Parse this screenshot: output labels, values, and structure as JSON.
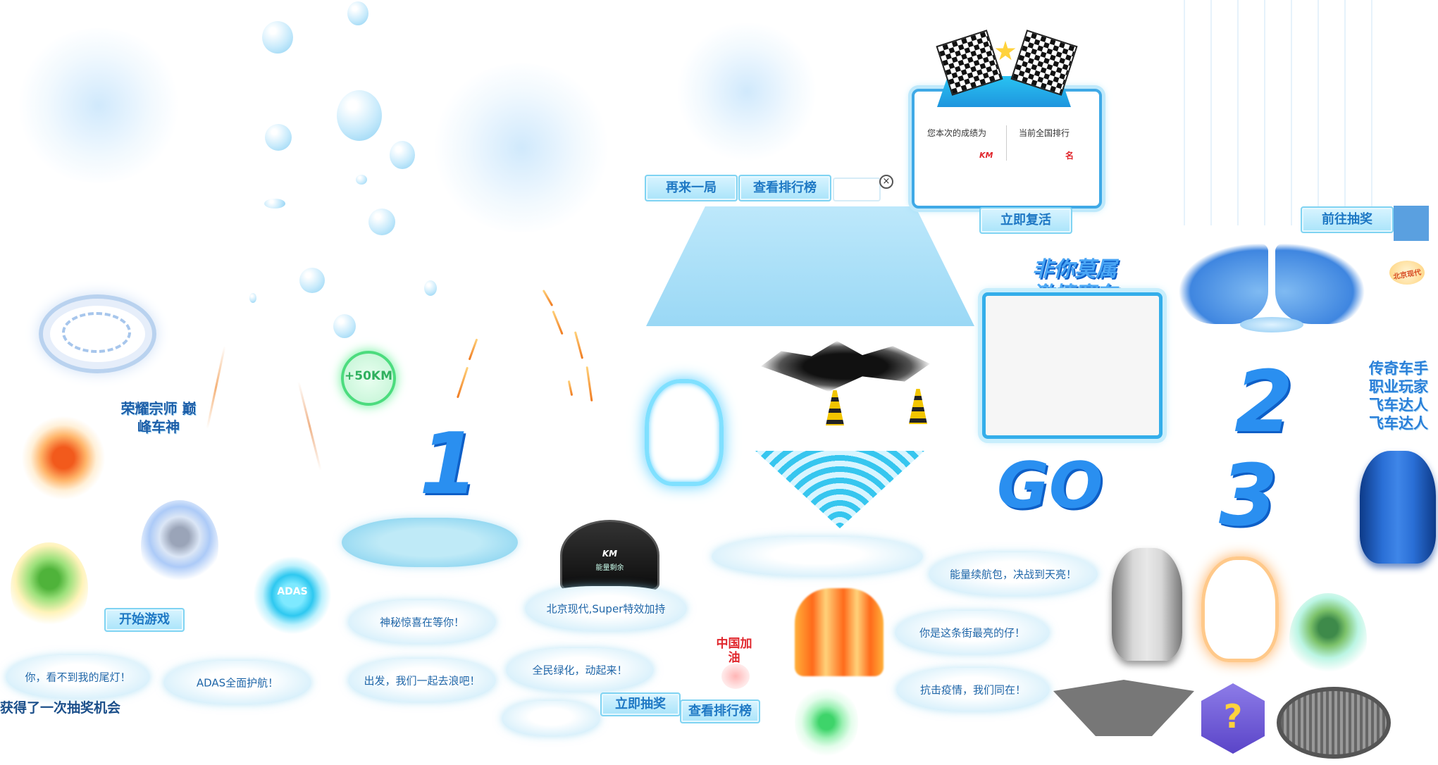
{
  "buttons": {
    "play_again": "再来一局",
    "view_rank_top": "查看排行榜",
    "revive": "立即复活",
    "go_lottery": "前往抽奖",
    "start_game": "开始游戏",
    "draw_now": "立即抽奖",
    "view_rank_bottom": "查看排行榜"
  },
  "result_panel": {
    "score_label": "您本次的成绩为",
    "score_unit": "KM",
    "rank_label": "当前全国排行",
    "rank_unit": "名"
  },
  "badges": {
    "bonus_km": "+50KM",
    "adas": "ADAS",
    "dash_km": "KM",
    "dash_energy": "能量剩余",
    "china_fuel": "中国加油",
    "brand": "北京现代"
  },
  "countdown": {
    "one": "1",
    "two": "2",
    "three": "3",
    "go": "GO"
  },
  "slogans": {
    "left": "荣耀宗师 巅峰车神",
    "racing_line1": "非你莫属",
    "racing_line2": "激情赛车",
    "right_line1": "传奇车手",
    "right_line2": "职业玩家",
    "right_line3": "飞车达人",
    "right_line4": "飞车达人"
  },
  "clouds": {
    "tail_light": "你，看不到我的尾灯！",
    "adas_nav": "ADAS全面护航！",
    "surprise": "神秘惊喜在等你！",
    "go_wave": "出发，我们一起去浪吧！",
    "super_effect": "北京现代,Super特效加持",
    "green_drive": "全民绿化，动起来！",
    "energy_pack": "能量续航包，决战到天亮！",
    "brightest": "你是这条街最亮的仔！",
    "anti_epidemic": "抗击疫情，我们同在！"
  },
  "lottery_chance": "获得了一次抽奖机会",
  "icons": [
    "close-icon",
    "checkered-flag-icon",
    "engine-icon",
    "sprout-icon",
    "hyundai-logo-icon",
    "adas-icon",
    "battery-icon",
    "mystery-box-icon",
    "manhole-icon",
    "traffic-cone-icon",
    "wings-icon",
    "car-icon",
    "dashboard-icon",
    "fire-icon",
    "cloud-icon",
    "droplet-icon",
    "earth-icon"
  ],
  "colors": {
    "accent": "#2a8ff0",
    "button_text": "#1e78c4",
    "cloud_text": "#1f66a8",
    "flag_red": "#e0262c"
  }
}
